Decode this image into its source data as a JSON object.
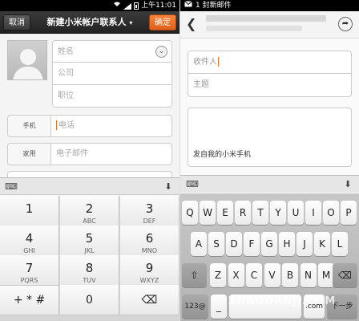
{
  "left": {
    "status": {
      "time": "上午11:01"
    },
    "titlebar": {
      "cancel": "取消",
      "title": "新建小米帐户联系人",
      "ok": "确定"
    },
    "form": {
      "name_placeholder": "姓名",
      "company_placeholder": "公司",
      "jobtitle_placeholder": "职位",
      "phone_label": "手机",
      "phone_placeholder": "电话",
      "email_label": "家用",
      "email_placeholder": "电子邮件"
    },
    "keypad": {
      "keys": [
        {
          "n": "1",
          "l": ""
        },
        {
          "n": "2",
          "l": "ABC"
        },
        {
          "n": "3",
          "l": "DEF"
        },
        {
          "n": "4",
          "l": "GHI"
        },
        {
          "n": "5",
          "l": "JKL"
        },
        {
          "n": "6",
          "l": "MNO"
        },
        {
          "n": "7",
          "l": "PQRS"
        },
        {
          "n": "8",
          "l": "TUV"
        },
        {
          "n": "9",
          "l": "WXYZ"
        }
      ],
      "symbols": "+ * #",
      "zero": "0"
    },
    "colors": {
      "accent": "#f07020"
    }
  },
  "right": {
    "status": {
      "notification": "1 封新邮件"
    },
    "compose": {
      "to_placeholder": "收件人",
      "subject_placeholder": "主题",
      "signature": "发自我的小米手机"
    },
    "keyboard": {
      "row1": [
        "Q",
        "W",
        "E",
        "R",
        "T",
        "Y",
        "U",
        "I",
        "O",
        "P"
      ],
      "row2": [
        "A",
        "S",
        "D",
        "F",
        "G",
        "H",
        "J",
        "K",
        "L"
      ],
      "row3": [
        "Z",
        "X",
        "C",
        "V",
        "B",
        "N",
        "M"
      ],
      "mode_key": "123@",
      "dot_key": ".com",
      "next_key": "下一步"
    },
    "watermark": "ZHAODANJI.COM"
  }
}
